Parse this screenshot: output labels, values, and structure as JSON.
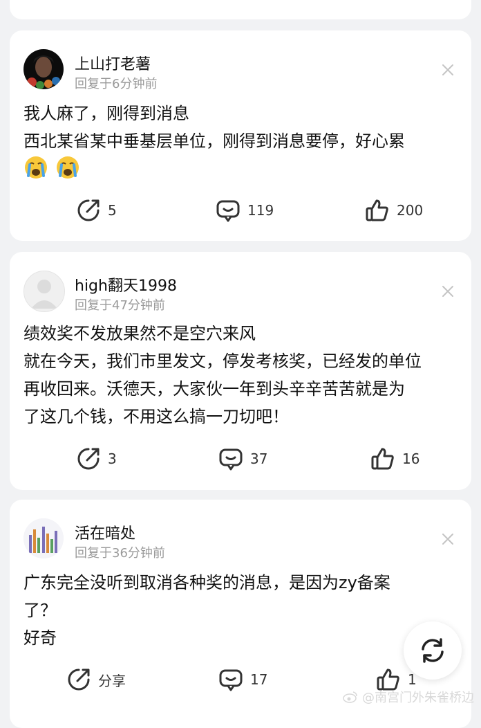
{
  "comments": [
    {
      "username": "上山打老薯",
      "reply_time": "回复于6分钟前",
      "lines": [
        "我人麻了，刚得到消息",
        "西北某省某中垂基层单位，刚得到消息要停，好心累"
      ],
      "emojis": [
        "crying-face-emoji",
        "crying-face-emoji"
      ],
      "share_label": "5",
      "comment_count": "119",
      "like_count": "200"
    },
    {
      "username": "high翻天1998",
      "reply_time": "回复于47分钟前",
      "lines": [
        "绩效奖不发放果然不是空穴来风",
        "就在今天，我们市里发文，停发考核奖，已经发的单位",
        "再收回来。沃德天，大家伙一年到头辛辛苦苦就是为",
        "了这几个钱，不用这么搞一刀切吧！"
      ],
      "share_label": "3",
      "comment_count": "37",
      "like_count": "16"
    },
    {
      "username": "活在暗处",
      "reply_time": "回复于36分钟前",
      "lines": [
        "广东完全没听到取消各种奖的消息，是因为zy备案",
        "了？",
        "好奇"
      ],
      "share_label": "分享",
      "comment_count": "17",
      "like_count": "1"
    }
  ],
  "watermark": "@南宫门外朱雀桥边",
  "colors": {
    "background": "#f1f2f4",
    "card": "#ffffff",
    "meta_text": "#9a9a9a",
    "icon": "#333333"
  }
}
